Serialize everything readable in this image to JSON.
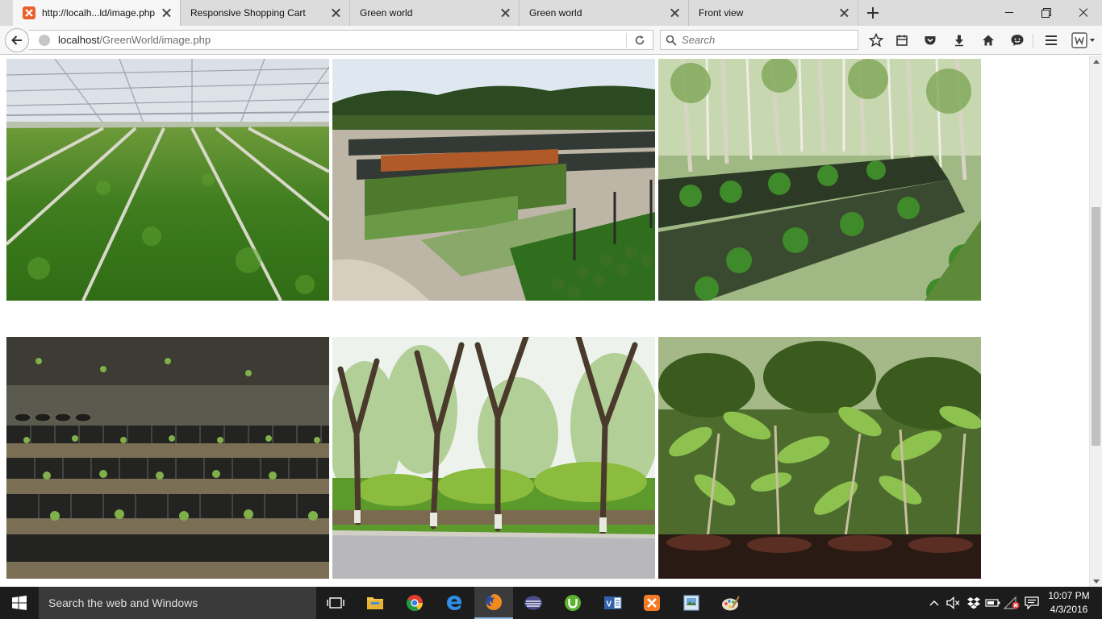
{
  "browser": {
    "tabs": [
      {
        "label": "http://localh...ld/image.php",
        "active": true
      },
      {
        "label": "Responsive Shopping Cart",
        "active": false
      },
      {
        "label": "Green world",
        "active": false
      },
      {
        "label": "Green world",
        "active": false
      },
      {
        "label": "Front view",
        "active": false
      }
    ],
    "url": {
      "host": "localhost",
      "path": "/GreenWorld/image.php"
    },
    "search": {
      "placeholder": "Search"
    }
  },
  "gallery": {
    "images": [
      {
        "subject": "greenhouse lettuce rows"
      },
      {
        "subject": "shade-net plant nursery"
      },
      {
        "subject": "forest seedling beds"
      },
      {
        "subject": "seedling bags in rows"
      },
      {
        "subject": "roadside trees and hedge"
      },
      {
        "subject": "potted tree saplings"
      }
    ]
  },
  "taskbar": {
    "search_placeholder": "Search the web and Windows",
    "apps": [
      "task-view",
      "file-explorer",
      "chrome",
      "edge",
      "firefox",
      "php-ide",
      "utorrent",
      "visual-studio",
      "xampp",
      "image-viewer",
      "paint"
    ],
    "clock": {
      "time": "10:07 PM",
      "date": "4/3/2016"
    }
  },
  "colors": {
    "tab_strip": "#dcdcdc",
    "nav_bar": "#f6f6f6",
    "taskbar": "#1c1c1c",
    "favicon": "#e8602c"
  }
}
